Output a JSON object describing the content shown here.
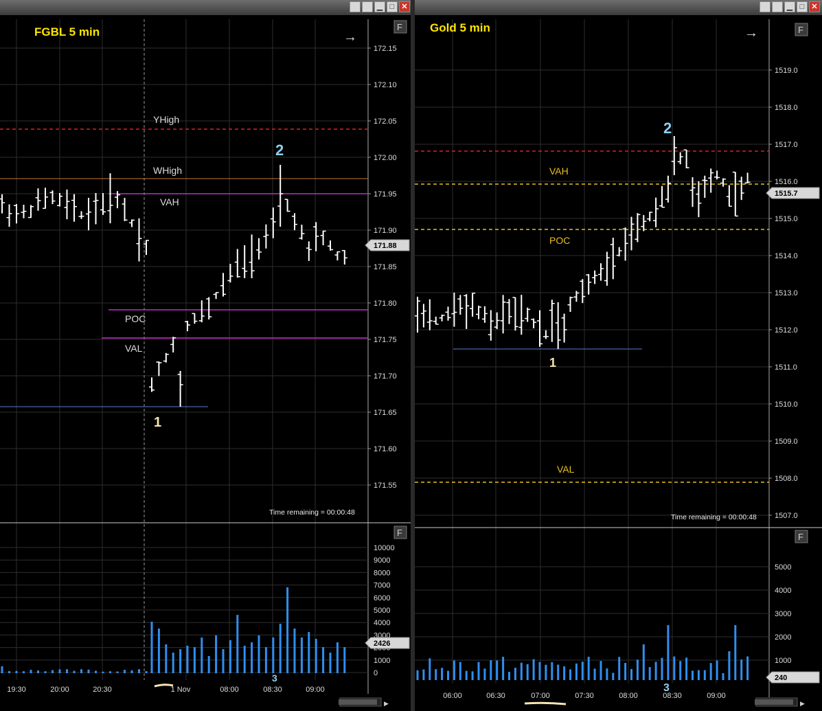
{
  "left": {
    "title": "FGBL  5 min",
    "price_axis": [
      "172.15",
      "172.10",
      "172.05",
      "172.00",
      "171.95",
      "171.90",
      "171.85",
      "171.80",
      "171.75",
      "171.70",
      "171.65",
      "171.60",
      "171.55"
    ],
    "current_price": "171.88",
    "volume_axis": [
      "10000",
      "9000",
      "8000",
      "7000",
      "6000",
      "5000",
      "4000",
      "3000",
      "2000",
      "1000",
      "0"
    ],
    "current_volume": "2426",
    "time_axis": [
      "19:30",
      "20:00",
      "20:30",
      "1 Nov",
      "08:00",
      "08:30",
      "09:00"
    ],
    "levels": {
      "yhigh": "YHigh",
      "whigh": "WHigh",
      "vah": "VAH",
      "poc": "POC",
      "val": "VAL"
    },
    "annotations": {
      "one": "1",
      "two": "2",
      "three": "3"
    },
    "time_remaining": "Time remaining = 00:00:48",
    "f_button": "F"
  },
  "right": {
    "title": "Gold  5 min",
    "price_axis": [
      "1519.0",
      "1518.0",
      "1517.0",
      "1516.0",
      "1515.0",
      "1514.0",
      "1513.0",
      "1512.0",
      "1511.0",
      "1510.0",
      "1509.0",
      "1508.0",
      "1507.0"
    ],
    "current_price": "1515.7",
    "volume_axis": [
      "5000",
      "4000",
      "3000",
      "2000",
      "1000"
    ],
    "current_volume": "240",
    "time_axis": [
      "06:00",
      "06:30",
      "07:00",
      "07:30",
      "08:00",
      "08:30",
      "09:00"
    ],
    "levels": {
      "vah": "VAH",
      "poc": "POC",
      "val": "VAL"
    },
    "annotations": {
      "one": "1",
      "two": "2",
      "three": "3"
    },
    "time_remaining": "Time remaining = 00:00:48",
    "f_button": "F"
  },
  "colors": {
    "title": "#ffe600",
    "red": "#e02020",
    "orange": "#c87830",
    "magenta": "#c030c0",
    "blue": "#5b7bd6",
    "gold": "#e8c020",
    "volume": "#2f8ff0",
    "grid": "#2e2e2e"
  },
  "window_buttons": [
    "restore",
    "minimize",
    "maximize",
    "close"
  ]
}
